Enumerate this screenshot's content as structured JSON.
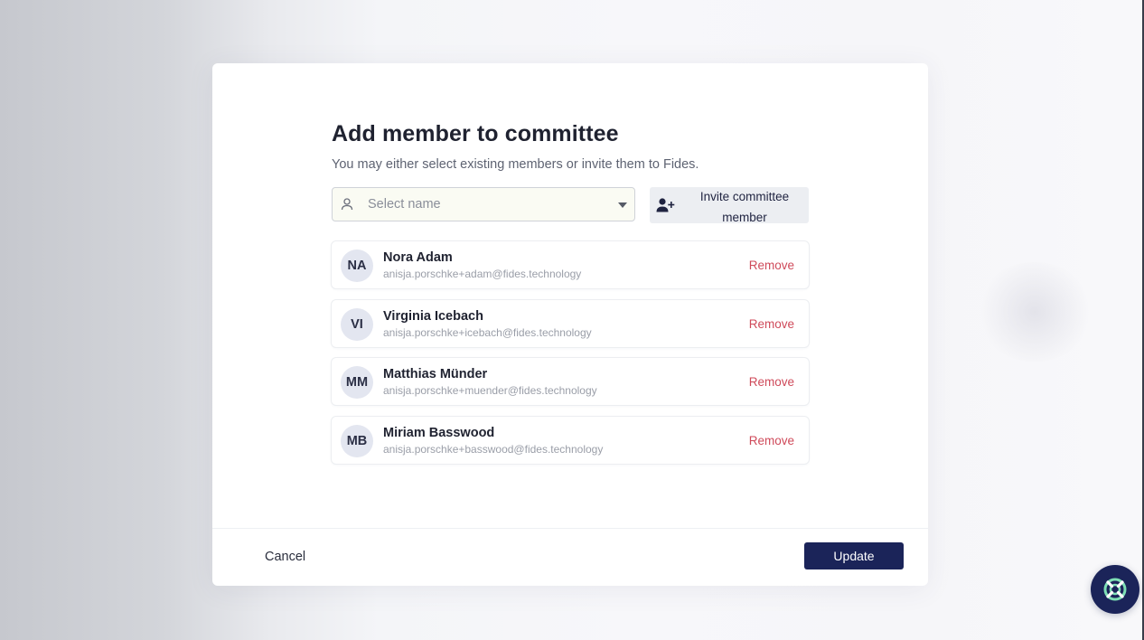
{
  "modal": {
    "title": "Add member to committee",
    "subtitle": "You may either select existing members or invite them to Fides.",
    "select": {
      "placeholder": "Select name",
      "icon": "person-icon"
    },
    "invite_button": {
      "label_line1": "Invite committee",
      "label_line2": "member",
      "icon": "user-plus-icon"
    },
    "members": [
      {
        "initials": "NA",
        "name": "Nora Adam",
        "email": "anisja.porschke+adam@fides.technology",
        "action": "Remove"
      },
      {
        "initials": "VI",
        "name": "Virginia Icebach",
        "email": "anisja.porschke+icebach@fides.technology",
        "action": "Remove"
      },
      {
        "initials": "MM",
        "name": "Matthias Münder",
        "email": "anisja.porschke+muender@fides.technology",
        "action": "Remove"
      },
      {
        "initials": "MB",
        "name": "Miriam Basswood",
        "email": "anisja.porschke+basswood@fides.technology",
        "action": "Remove"
      }
    ],
    "footer": {
      "cancel_label": "Cancel",
      "update_label": "Update"
    }
  },
  "help_fab": {
    "icon": "lifebuoy-icon"
  },
  "colors": {
    "primary": "#1b2459",
    "danger": "#cf4a5a",
    "avatar_bg": "#e3e6f0",
    "accent_green": "#7ee0b5"
  }
}
